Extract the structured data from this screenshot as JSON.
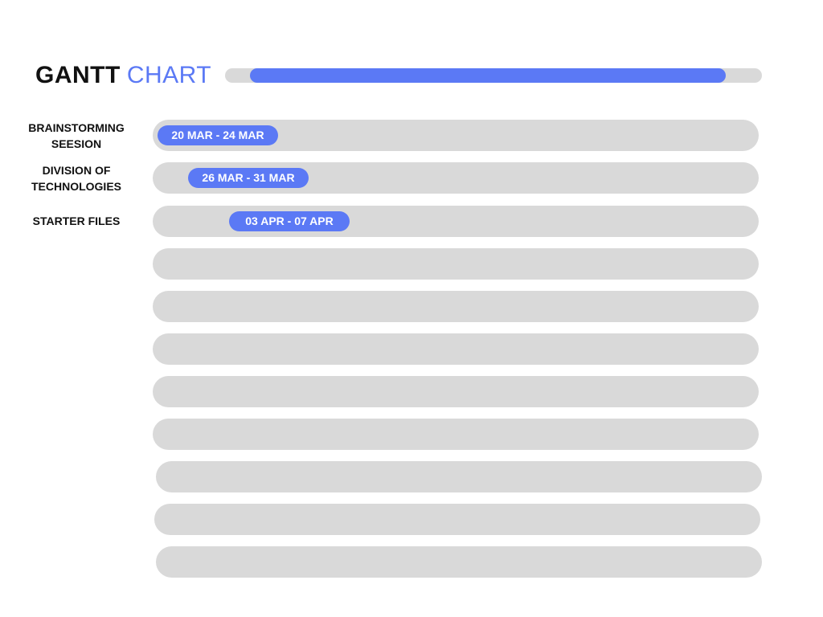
{
  "title": {
    "part1": "GANTT",
    "part2": "CHART"
  },
  "colors": {
    "accent": "#5b79f5",
    "track": "#d9d9d9",
    "text": "#111111",
    "bar_text": "#ffffff"
  },
  "progress": {
    "fraction": 0.93
  },
  "chart_data": {
    "type": "gantt",
    "row_count": 11,
    "x_range": [
      "2023-03-19",
      "2023-05-19"
    ],
    "tasks": [
      {
        "name": "BRAINSTORMING\nSEESION",
        "start": "2023-03-20",
        "end": "2023-03-24",
        "label": "20 MAR - 24 MAR"
      },
      {
        "name": "DIVISION OF\nTECHNOLOGIES",
        "start": "2023-03-26",
        "end": "2023-03-31",
        "label": "26 MAR - 31 MAR"
      },
      {
        "name": "STARTER FILES",
        "start": "2023-04-03",
        "end": "2023-04-07",
        "label": "03 APR - 07 APR"
      }
    ]
  }
}
